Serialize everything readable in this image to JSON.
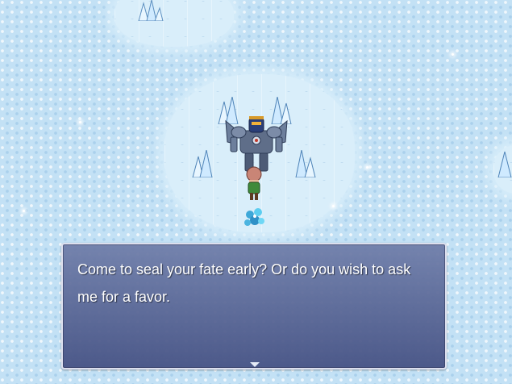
{
  "scene": {
    "description_free": true
  },
  "dialog": {
    "lines": [
      "Come to seal your fate early? Or do you wish to ask",
      "me for a favor."
    ],
    "continue_indicator": "down-triangle"
  },
  "icons": {
    "boss": "ice-demon-sprite",
    "player": "player-character-sprite",
    "crystal": "ice-crystal-sprite",
    "flower": "frost-flower-sprite"
  },
  "colors": {
    "snow": "#c3e1f5",
    "ice_floor": "#d9eefa",
    "window_top": "#6e7ca8",
    "window_bottom": "#465284",
    "text": "#ffffff"
  }
}
